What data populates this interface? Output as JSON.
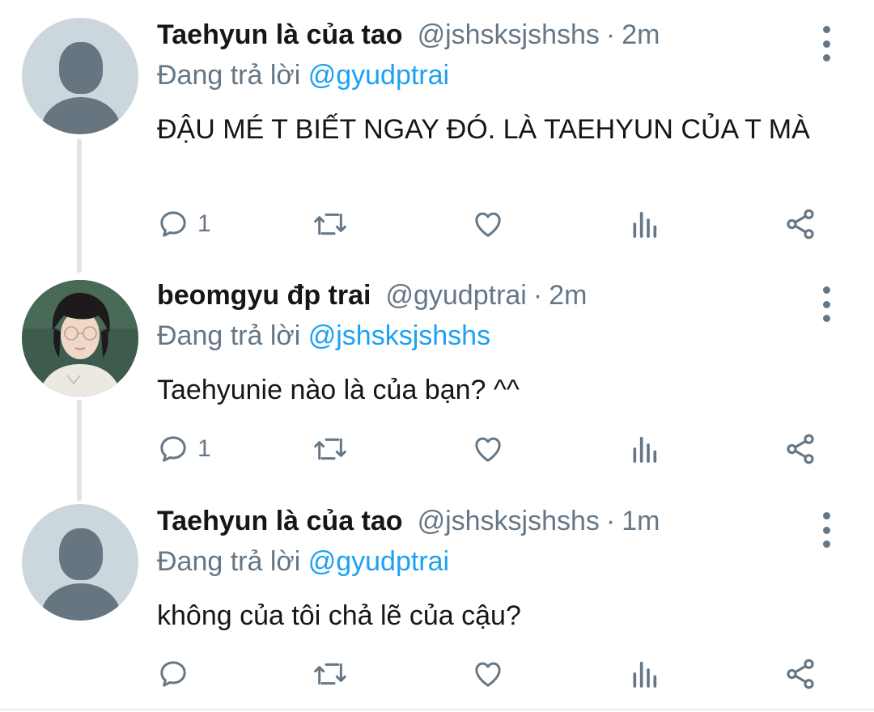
{
  "colors": {
    "link": "#1da1f2",
    "secondary_text": "#657786",
    "primary_text": "#14171a",
    "thread_line": "#e1e4e8",
    "default_avatar_bg": "#ccd6dd",
    "default_avatar_fg": "#66757f"
  },
  "tweets": [
    {
      "display_name": "Taehyun là của tao",
      "handle": "@jshsksjshshs",
      "separator": "·",
      "time": "2m",
      "reply_prefix": "Đang trả lời",
      "reply_to": "@gyudptrai",
      "text": "ĐẬU MÉ T BIẾT NGAY ĐÓ. LÀ TAEHYUN CỦA T MÀ",
      "avatar": "default-avatar",
      "reply_count": "1",
      "icons": [
        "reply-icon",
        "retweet-icon",
        "like-icon",
        "analytics-icon",
        "share-icon",
        "more-icon"
      ]
    },
    {
      "display_name": "beomgyu đp trai",
      "handle": "@gyudptrai",
      "separator": "·",
      "time": "2m",
      "reply_prefix": "Đang trả lời",
      "reply_to": "@jshsksjshshs",
      "text": "Taehyunie nào là của bạn? ^^",
      "avatar": "photo-avatar",
      "reply_count": "1",
      "icons": [
        "reply-icon",
        "retweet-icon",
        "like-icon",
        "analytics-icon",
        "share-icon",
        "more-icon"
      ]
    },
    {
      "display_name": "Taehyun là của tao",
      "handle": "@jshsksjshshs",
      "separator": "·",
      "time": "1m",
      "reply_prefix": "Đang trả lời",
      "reply_to": "@gyudptrai",
      "text": "không của tôi chả lẽ của cậu?",
      "avatar": "default-avatar",
      "reply_count": "",
      "icons": [
        "reply-icon",
        "retweet-icon",
        "like-icon",
        "analytics-icon",
        "share-icon",
        "more-icon"
      ]
    }
  ]
}
